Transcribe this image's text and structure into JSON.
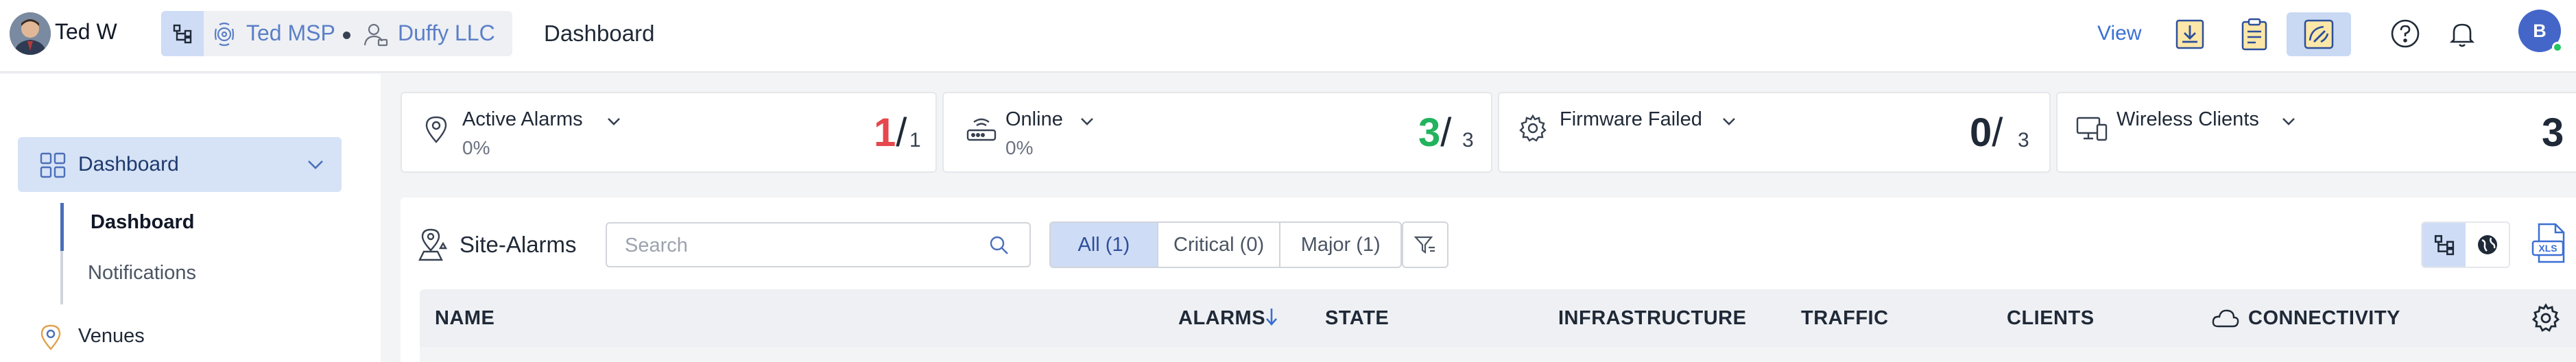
{
  "header": {
    "user_name": "Ted W",
    "context": {
      "msp": "Ted MSP",
      "customer": "Duffy LLC"
    },
    "page_title": "Dashboard",
    "view_label": "View",
    "avatar_initial": "B"
  },
  "sidebar": {
    "section": "Dashboard",
    "sub_items": [
      "Dashboard",
      "Notifications"
    ],
    "venues": "Venues"
  },
  "stats": {
    "active_alarms": {
      "title": "Active Alarms",
      "pct": "0%",
      "value": "1",
      "total": "1",
      "value_color": "#e5484d"
    },
    "online": {
      "title": "Online",
      "pct": "0%",
      "value": "3",
      "total": "3",
      "value_color": "#22b35e"
    },
    "firmware_failed": {
      "title": "Firmware Failed",
      "value": "0",
      "total": "3",
      "value_color": "#1f2937"
    },
    "wireless_clients": {
      "title": "Wireless Clients",
      "value": "3",
      "value_color": "#1f2937"
    }
  },
  "site_alarms": {
    "title": "Site-Alarms",
    "search_placeholder": "Search",
    "filters": [
      "All (1)",
      "Critical (0)",
      "Major (1)"
    ],
    "active_filter": "All (1)",
    "columns": {
      "name": "NAME",
      "alarms": "ALARMS",
      "state": "STATE",
      "infrastructure": "INFRASTRUCTURE",
      "traffic": "TRAFFIC",
      "clients": "CLIENTS",
      "connectivity": "CONNECTIVITY"
    },
    "export_label": "XLS"
  },
  "colors": {
    "accent": "#3b6fd4",
    "active_bg": "#cfdcf6",
    "online": "#22c55e"
  }
}
